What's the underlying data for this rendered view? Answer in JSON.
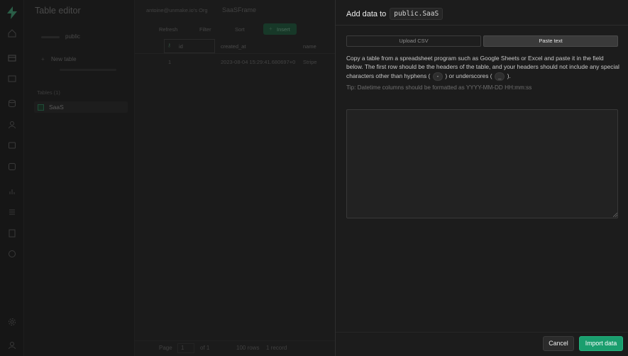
{
  "app": {
    "panel_title": "Table editor",
    "schema_label": "public",
    "new_table_label": "New table",
    "tables_header": "Tables (1)",
    "table_item": "SaaS"
  },
  "header": {
    "org": "antoine@unmake.io's Org",
    "project": "SaaSFrame"
  },
  "toolbar": {
    "refresh": "Refresh",
    "filter": "Filter",
    "sort": "Sort",
    "insert": "Insert"
  },
  "grid": {
    "columns": [
      "id",
      "created_at",
      "name"
    ],
    "rows": [
      [
        "1",
        "2023-08-04 15:29:41.680697+0",
        "Stripe"
      ]
    ]
  },
  "footer": {
    "page_label": "Page",
    "page_value": "1",
    "of_label": "of 1",
    "rows_per_page": "100 rows",
    "record_count": "1 record"
  },
  "sheet": {
    "heading": "Add data to",
    "table_ref": "public.SaaS",
    "tab_upload": "Upload CSV",
    "tab_paste": "Paste text",
    "desc_part1": "Copy a table from a spreadsheet program such as Google Sheets or Excel and paste it in the field below. The first row should be the headers of the table, and your headers should not include any special characters other than hyphens (",
    "hyphen_chip": "-",
    "desc_part2": ") or underscores (",
    "underscore_chip": "_",
    "desc_part3": ").",
    "tip": "Tip: Datetime columns should be formatted as YYYY-MM-DD HH:mm:ss",
    "textarea_value": "",
    "cancel": "Cancel",
    "import": "Import data"
  },
  "colors": {
    "accent": "#1a9e6e",
    "background": "#1c1c1c"
  },
  "icons": [
    "logo-icon",
    "home-icon",
    "table-editor-icon",
    "sql-editor-icon",
    "database-icon",
    "auth-icon",
    "storage-icon",
    "functions-icon",
    "reports-icon",
    "logs-icon",
    "api-docs-icon",
    "advisor-icon",
    "settings-icon",
    "user-icon"
  ]
}
